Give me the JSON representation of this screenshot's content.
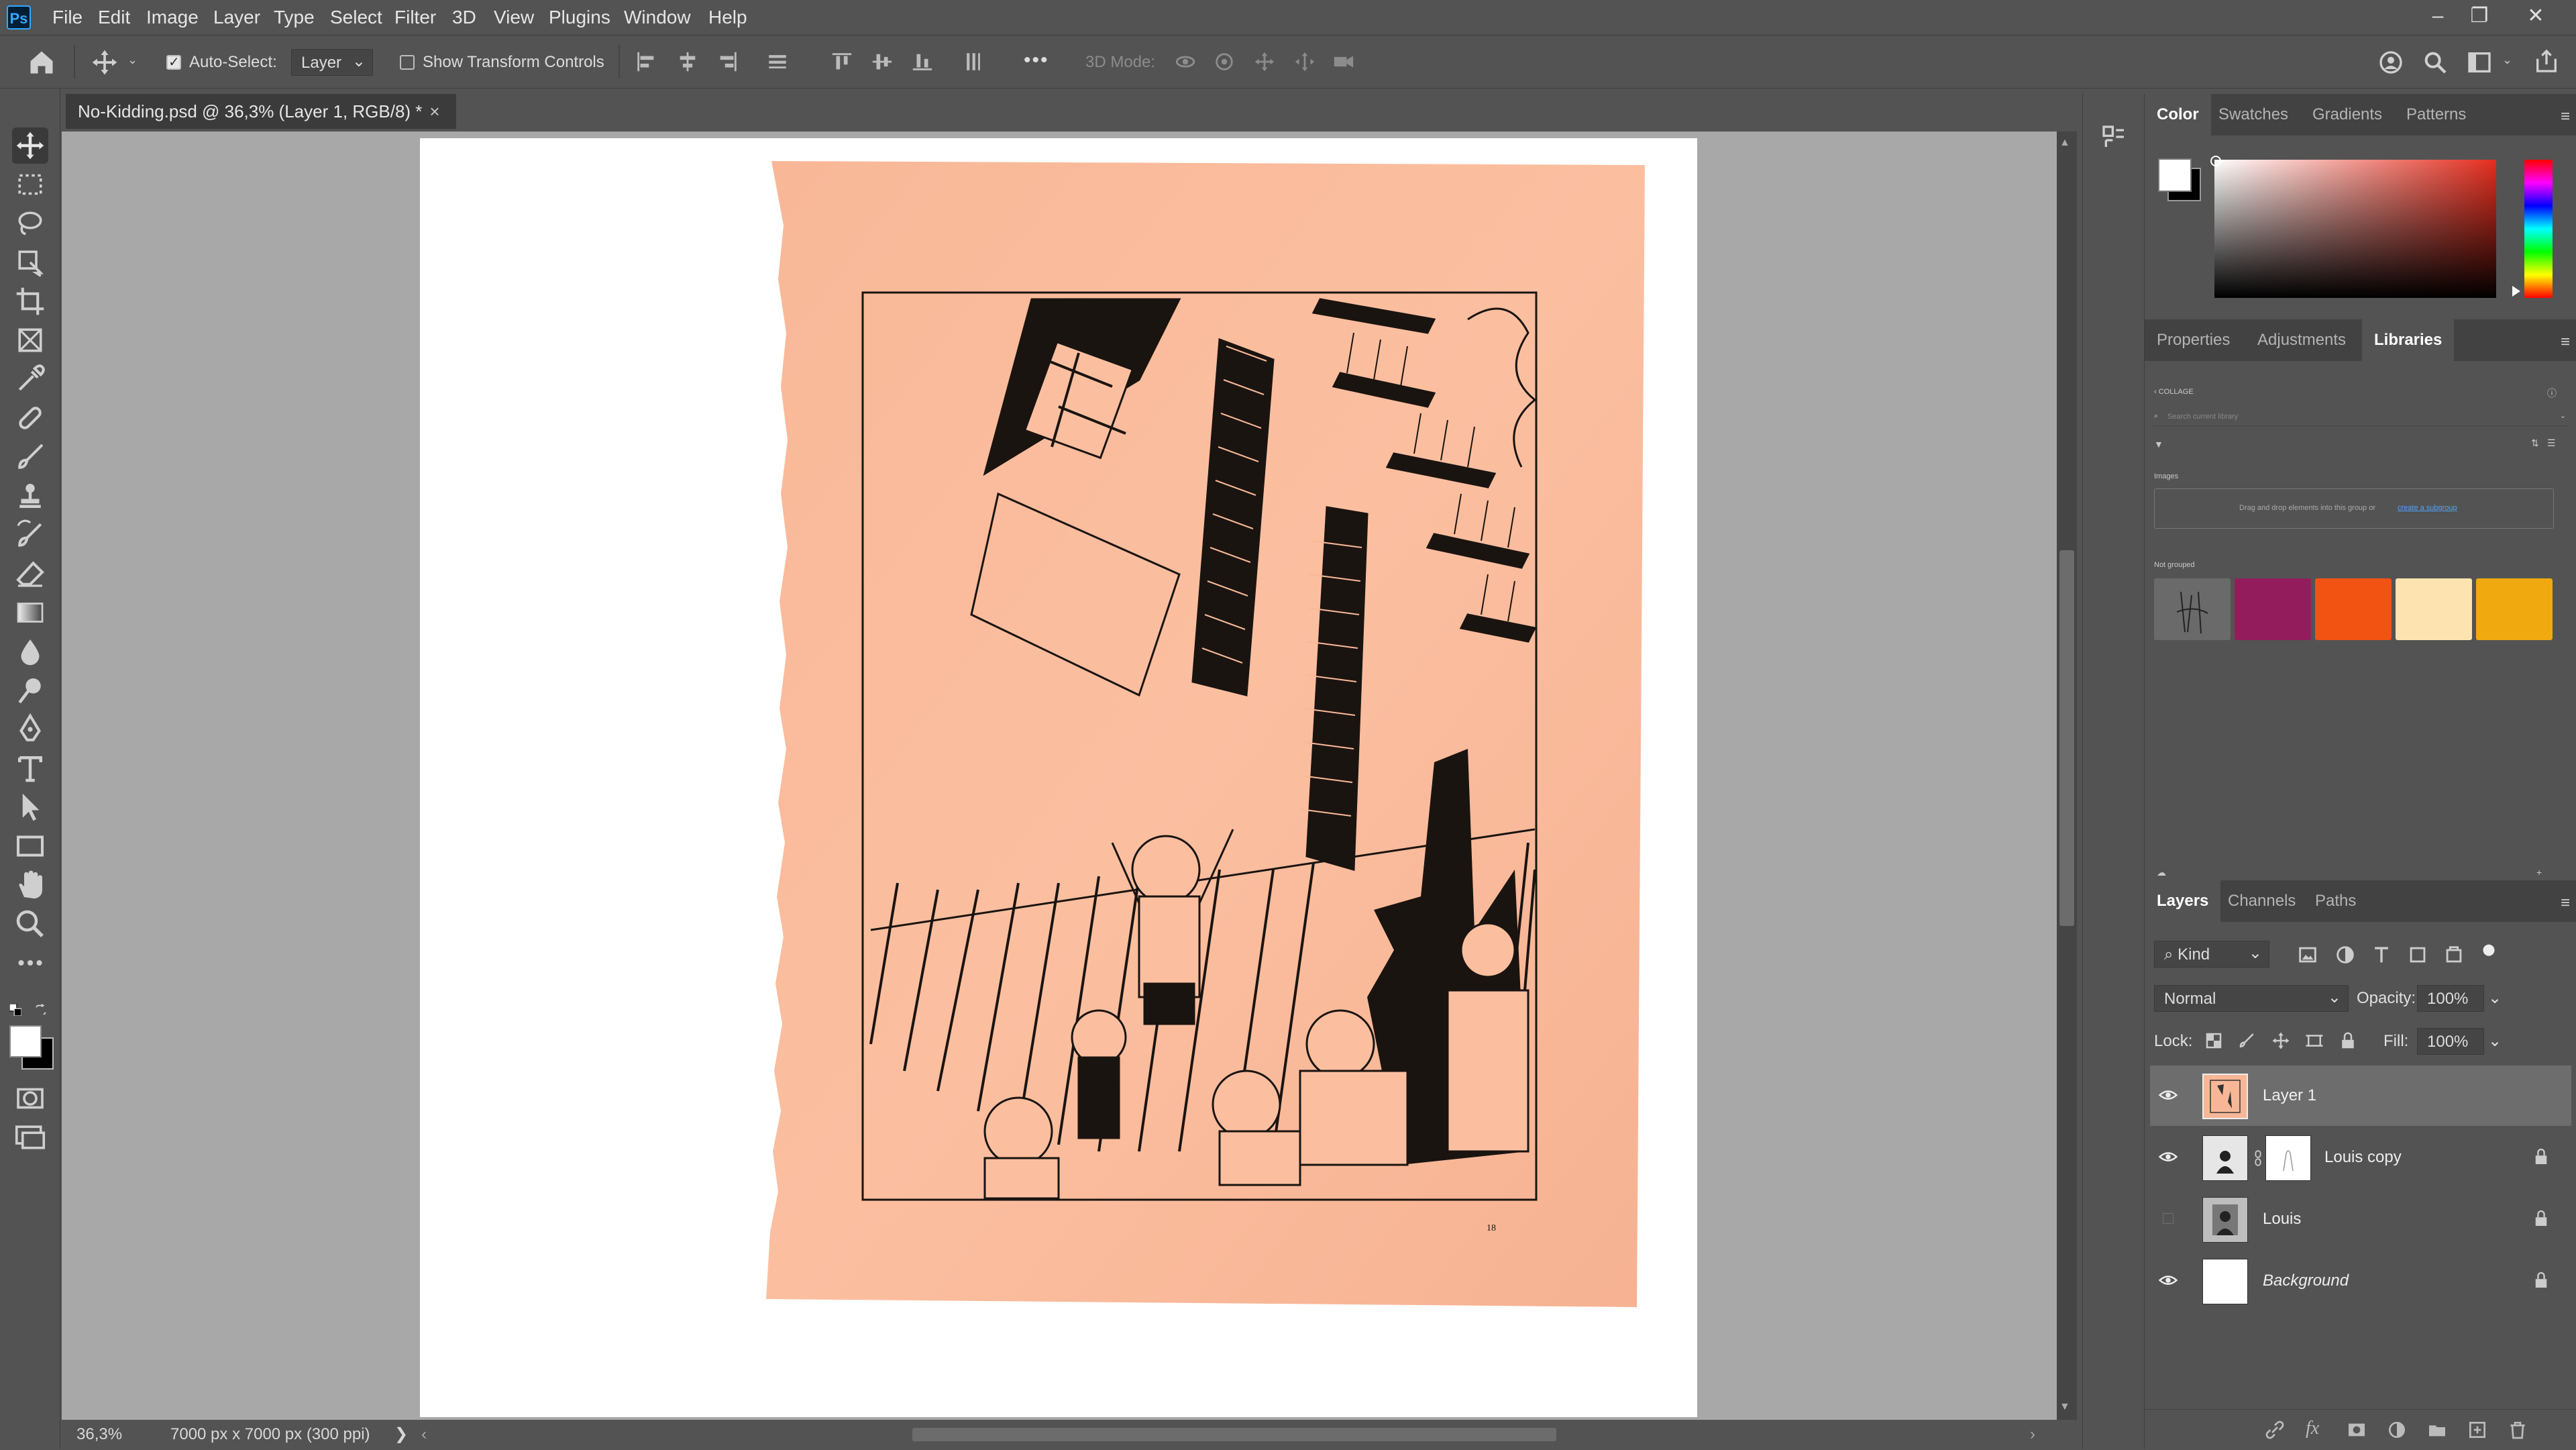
{
  "app": {
    "logo_text": "Ps"
  },
  "menu": [
    "File",
    "Edit",
    "Image",
    "Layer",
    "Type",
    "Select",
    "Filter",
    "3D",
    "View",
    "Plugins",
    "Window",
    "Help"
  ],
  "options": {
    "auto_select_label": "Auto-Select:",
    "auto_select_checked": true,
    "auto_select_target": "Layer",
    "show_transform_label": "Show Transform Controls",
    "show_transform_checked": false,
    "mode_3d_label": "3D Mode:",
    "more": "•••"
  },
  "document": {
    "tab_title": "No-Kidding.psd @ 36,3% (Layer 1, RGB/8) *",
    "close_glyph": "×"
  },
  "status": {
    "zoom": "36,3%",
    "doc_info": "7000 px x 7000 px (300 ppi)",
    "arrow": "❯"
  },
  "artwork": {
    "page_number": "18"
  },
  "color_panel": {
    "tabs": [
      "Color",
      "Swatches",
      "Gradients",
      "Patterns"
    ],
    "active_tab": "Color",
    "foreground": "#ffffff",
    "background": "#000000",
    "hue_color": "#e52e1f"
  },
  "libraries_panel": {
    "tabs": [
      "Properties",
      "Adjustments",
      "Libraries"
    ],
    "active_tab": "Libraries",
    "breadcrumb": "‹ COLLAGE",
    "search_placeholder": "Search current library",
    "section_images": "Images",
    "drop_hint": "Drag and drop elements into this group or",
    "drop_link": "create a subgroup",
    "not_grouped": "Not grouped",
    "swatches": [
      "#931d5c",
      "#f25312",
      "#fde3b0",
      "#f0aa10"
    ]
  },
  "layers_panel": {
    "tabs": [
      "Layers",
      "Channels",
      "Paths"
    ],
    "active_tab": "Layers",
    "filter_kind": "Kind",
    "blend_mode": "Normal",
    "opacity_label": "Opacity:",
    "opacity_value": "100%",
    "lock_label": "Lock:",
    "fill_label": "Fill:",
    "fill_value": "100%",
    "layers": [
      {
        "name": "Layer 1",
        "visible": true,
        "locked": false,
        "selected": true
      },
      {
        "name": "Louis copy",
        "visible": true,
        "locked": true,
        "selected": false
      },
      {
        "name": "Louis",
        "visible": false,
        "locked": true,
        "selected": false
      },
      {
        "name": "Background",
        "visible": true,
        "locked": true,
        "selected": false
      }
    ]
  }
}
